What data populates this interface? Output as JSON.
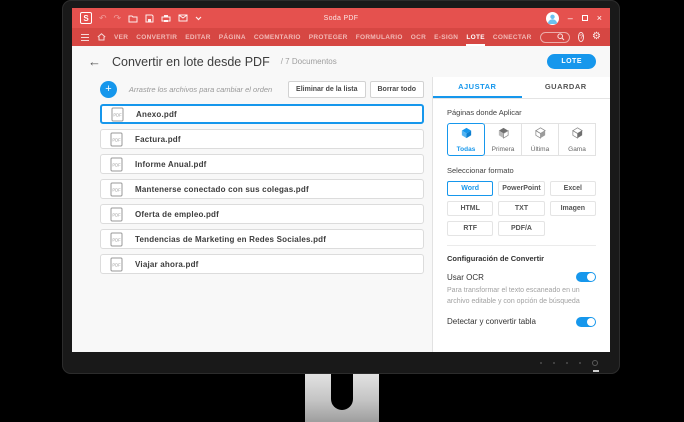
{
  "window": {
    "app_title": "Soda PDF",
    "minimize_glyph": "–",
    "close_glyph": "×",
    "logo_letter": "S"
  },
  "icons": {
    "undo": "↶",
    "redo": "↷",
    "help": "?",
    "gear": "⚙",
    "back_arrow": "←",
    "add": "+"
  },
  "menubar": {
    "items": [
      "VER",
      "CONVERTIR",
      "EDITAR",
      "PÁGINA",
      "COMENTARIO",
      "PROTEGER",
      "FORMULARIO",
      "OCR",
      "E-SIGN",
      "LOTE",
      "CONECTAR"
    ],
    "active_item": "LOTE",
    "search_value": ""
  },
  "header": {
    "title": "Convertir en lote desde PDF",
    "breadcrumb": "/ 7 Documentos",
    "lote_button": "LOTE"
  },
  "file_list": {
    "drag_hint": "Arrastre los archivos para cambiar el orden",
    "remove_button": "Eliminar de la lista",
    "clear_button": "Borrar todo",
    "selected_index": 0,
    "files": [
      "Anexo.pdf",
      "Factura.pdf",
      "Informe Anual.pdf",
      "Mantenerse conectado con sus colegas.pdf",
      "Oferta de empleo.pdf",
      "Tendencias de Marketing en Redes Sociales.pdf",
      "Viajar ahora.pdf"
    ]
  },
  "side_panel": {
    "tabs": [
      "AJUSTAR",
      "GUARDAR"
    ],
    "active_tab": "AJUSTAR",
    "pages_label": "Páginas donde Aplicar",
    "page_options": [
      "Todas",
      "Primera",
      "Última",
      "Gama"
    ],
    "selected_page_option": "Todas",
    "format_label": "Seleccionar formato",
    "formats": [
      "Word",
      "PowerPoint",
      "Excel",
      "HTML",
      "TXT",
      "Imagen",
      "RTF",
      "PDF/A"
    ],
    "selected_format": "Word",
    "config_label": "Configuración de Convertir",
    "ocr_label": "Usar OCR",
    "ocr_enabled": true,
    "ocr_description": "Para transformar el texto escaneado en un archivo editable y con opción de búsqueda",
    "table_label": "Detectar y convertir tabla",
    "table_enabled": true
  },
  "colors": {
    "titlebar_red": "#e5514e",
    "menubar_red": "#d64743",
    "accent_blue": "#1697ec",
    "avatar_blue": "#6cc2ef"
  }
}
